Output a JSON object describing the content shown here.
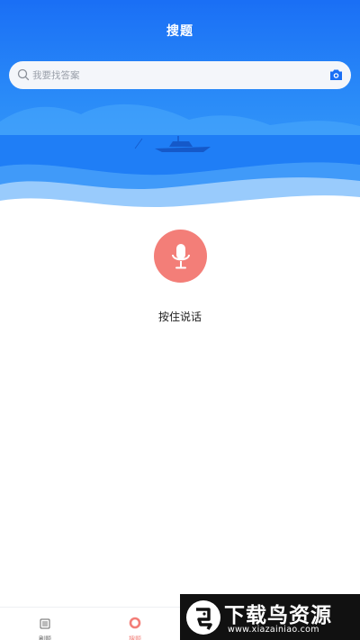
{
  "header": {
    "title": "搜题"
  },
  "search": {
    "placeholder": "我要找答案"
  },
  "voice": {
    "label": "按住说话"
  },
  "bottom_nav": {
    "items": [
      {
        "label": "刷题",
        "icon": "list-icon",
        "active": false
      },
      {
        "label": "搜题",
        "icon": "ring-icon",
        "active": true
      }
    ]
  },
  "watermark": {
    "title": "下载鸟资源",
    "url": "www.xiazainiao.com"
  },
  "colors": {
    "primary_blue": "#1a6ff5",
    "accent_coral": "#f37e78",
    "search_bg": "#f4f6fa"
  }
}
